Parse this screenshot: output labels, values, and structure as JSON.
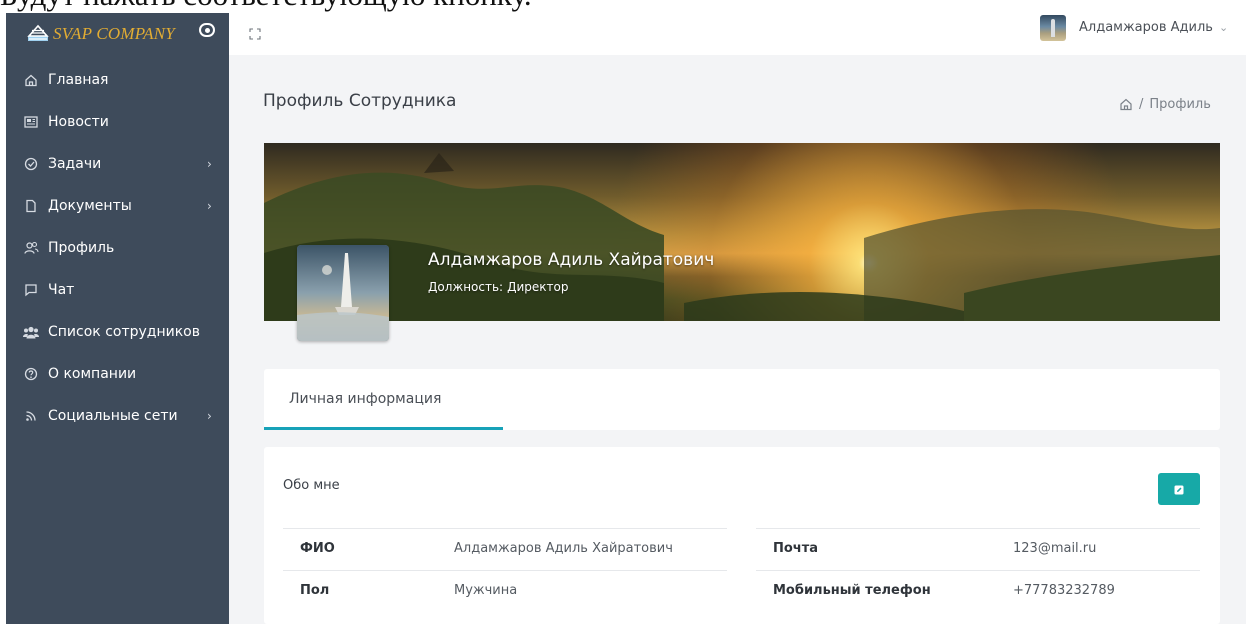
{
  "document": {
    "top_snippet": "Будут нажать соответствующую кнопку."
  },
  "brand": {
    "name": "SVAP COMPANY",
    "color": "#e3ad33",
    "logo_icon": "building-icon",
    "toggle_icon": "toggle-icon"
  },
  "sidebar": {
    "background": "#3e4b5b",
    "items": [
      {
        "label": "Главная",
        "icon": "home-icon",
        "has_arrow": false
      },
      {
        "label": "Новости",
        "icon": "newspaper-icon",
        "has_arrow": false
      },
      {
        "label": "Задачи",
        "icon": "check-circle-icon",
        "has_arrow": true
      },
      {
        "label": "Документы",
        "icon": "document-icon",
        "has_arrow": true
      },
      {
        "label": "Профиль",
        "icon": "users-icon",
        "has_arrow": false
      },
      {
        "label": "Чат",
        "icon": "chat-icon",
        "has_arrow": false
      },
      {
        "label": "Список сотрудников",
        "icon": "group-icon",
        "has_arrow": false
      },
      {
        "label": "О компании",
        "icon": "help-circle-icon",
        "has_arrow": false
      },
      {
        "label": "Социальные сети",
        "icon": "rss-icon",
        "has_arrow": true
      }
    ]
  },
  "header": {
    "user_name": "Алдамжаров Адиль",
    "caret": "⌄"
  },
  "page": {
    "title": "Профиль Сотрудника",
    "breadcrumb_separator": "/",
    "breadcrumb_current": "Профиль"
  },
  "profile": {
    "full_name": "Алдамжаров Адиль Хайратович",
    "position_label": "Должность:",
    "position_value": "Директор"
  },
  "tabs": [
    {
      "label": "Личная информация",
      "active": true
    }
  ],
  "info_card": {
    "title": "Обо мне",
    "accent_color": "#17a9a7",
    "left_rows": [
      {
        "key": "ФИО",
        "value": "Алдамжаров Адиль Хайратович"
      },
      {
        "key": "Пол",
        "value": "Мужчина"
      }
    ],
    "right_rows": [
      {
        "key": "Почта",
        "value": "123@mail.ru"
      },
      {
        "key": "Мобильный телефон",
        "value": "+77783232789"
      }
    ]
  }
}
